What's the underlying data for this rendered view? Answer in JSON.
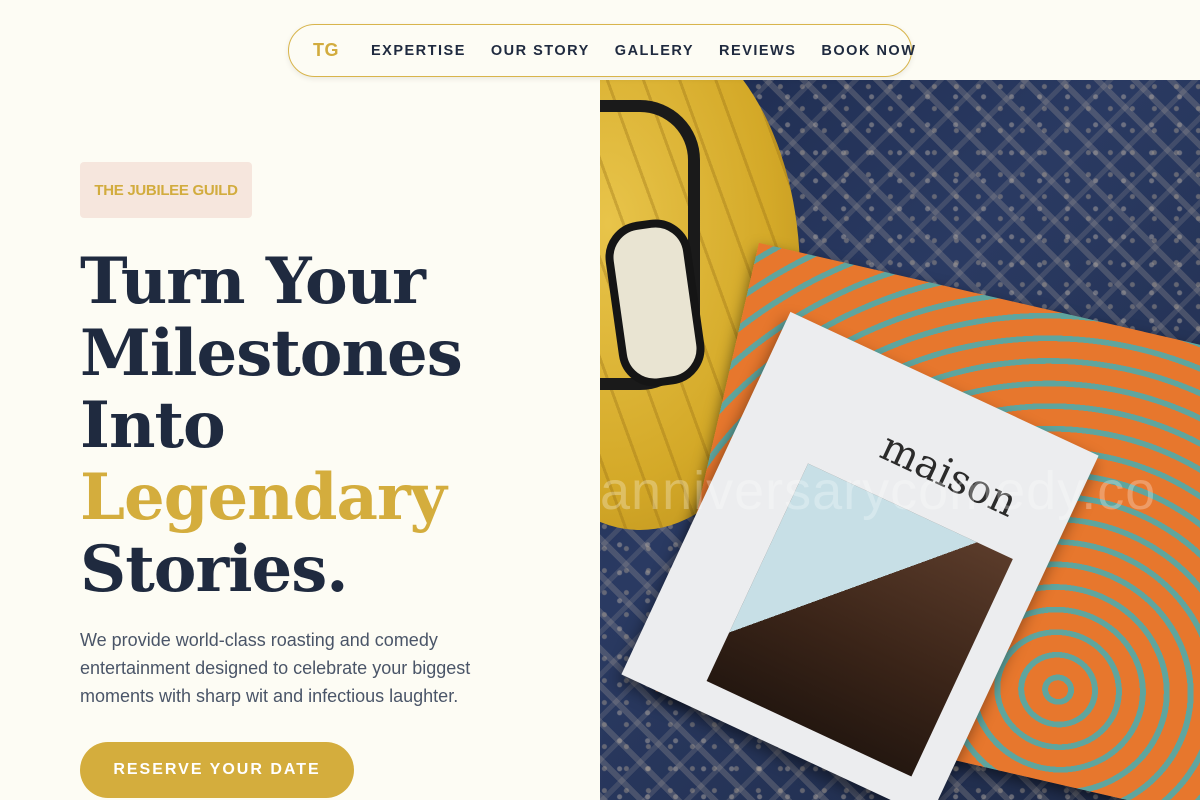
{
  "nav": {
    "logo": "TG",
    "links": [
      {
        "label": "EXPERTISE"
      },
      {
        "label": "OUR STORY"
      },
      {
        "label": "GALLERY"
      },
      {
        "label": "REVIEWS"
      },
      {
        "label": "BOOK NOW"
      }
    ]
  },
  "hero": {
    "badge": "THE JUBILEE GUILD",
    "headline": [
      "Turn Your",
      "Milestones",
      "Into"
    ],
    "headline_accent": "Legendary",
    "headline_end": "Stories.",
    "description": "We provide world-class roasting and comedy entertainment designed to celebrate your biggest moments with sharp wit and infectious laughter.",
    "cta": "RESERVE YOUR DATE"
  },
  "photo": {
    "magazine_title": "maison",
    "watermark": "anniversarycomedy.co"
  },
  "colors": {
    "accent": "#d4ad3d",
    "text_dark": "#1f2a3f",
    "badge_bg": "#f6e6dd",
    "page_bg": "#fdfcf4"
  }
}
